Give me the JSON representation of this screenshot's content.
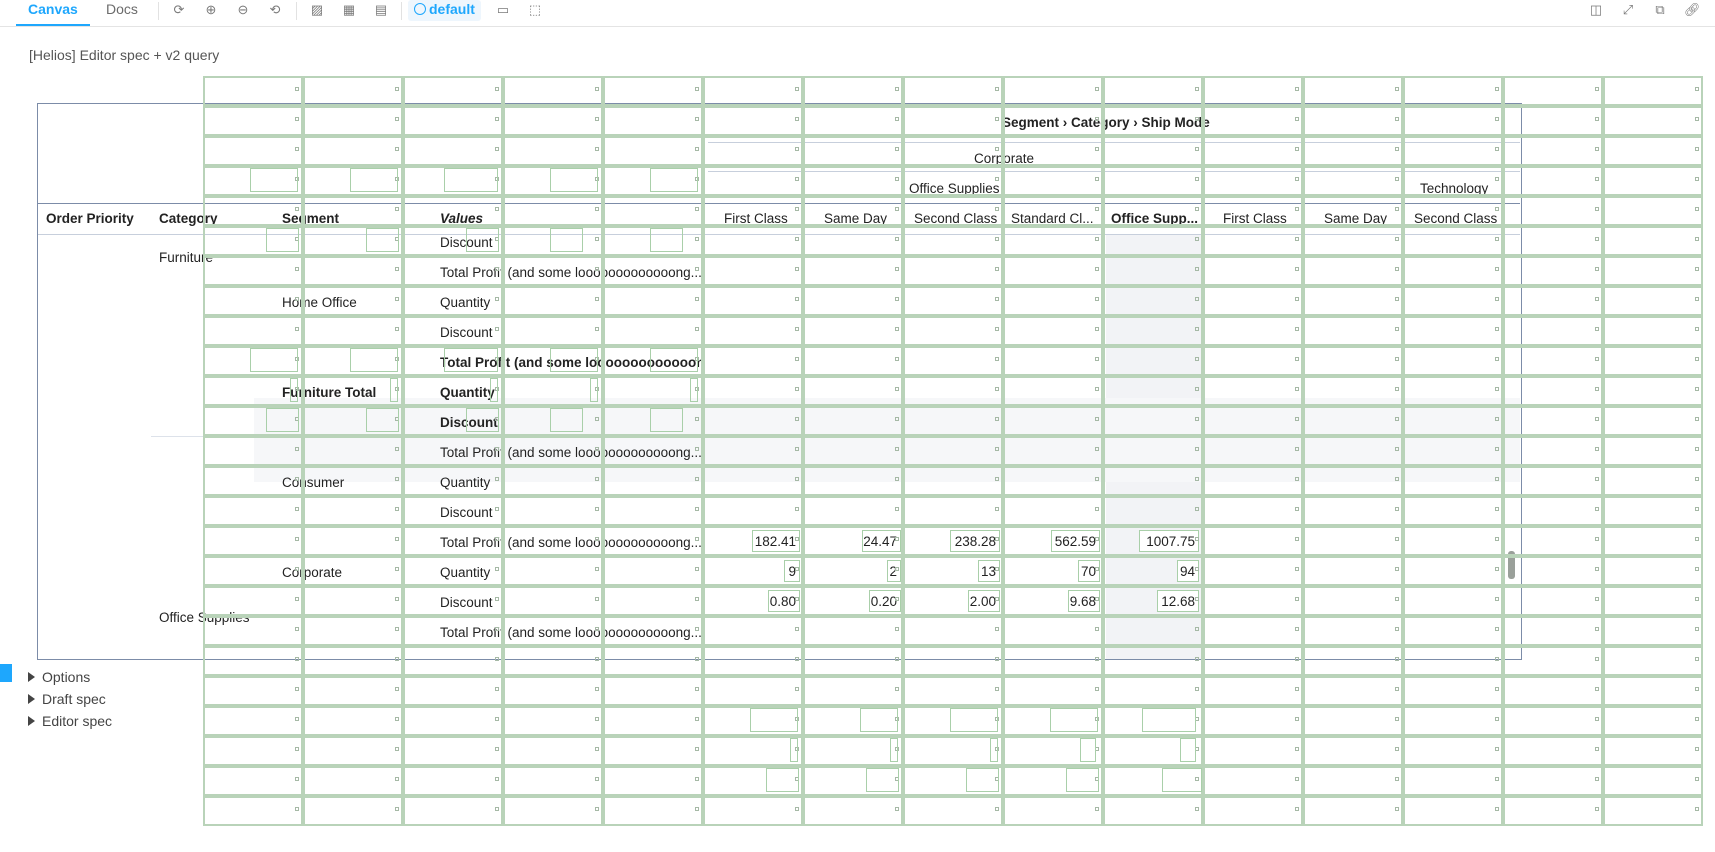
{
  "toolbar": {
    "tab_canvas": "Canvas",
    "tab_docs": "Docs",
    "globals_chip": "default",
    "icons": [
      "sync-icon",
      "zoom-in-icon",
      "zoom-out-icon",
      "zoom-reset-icon",
      "background-icon",
      "grid-icon",
      "outline-icon",
      "measure-icon",
      "viewport-icon",
      "sidebar-icon",
      "fullscreen-icon",
      "open-new-tab-icon",
      "copy-link-icon"
    ]
  },
  "story": {
    "title": "[Helios] Editor spec + v2 query"
  },
  "pivot": {
    "column_path": "Segment › Category › Ship Mode",
    "segment_header": "Corporate",
    "category_headers": [
      "Office Supplies",
      "Technology"
    ],
    "row_headers": [
      "Order Priority",
      "Category",
      "Segment",
      "Values"
    ],
    "col_headers": [
      "First Class",
      "Same Day",
      "Second Class",
      "Standard Cl...",
      "Office Supp...",
      "First Class",
      "Same Day",
      "Second Class"
    ],
    "categories": [
      "Furniture",
      "Office Supplies"
    ],
    "segments": [
      "Home Office",
      "Furniture Total",
      "Consumer",
      "Corporate"
    ],
    "value_names": {
      "discount": "Discount",
      "profit": "Total Profit (and some looooooooooooong...",
      "quantity": "Quantity"
    },
    "corporate_values": {
      "profit": [
        "182.41",
        "24.47",
        "238.28",
        "562.59",
        "1007.75"
      ],
      "quantity": [
        "9",
        "2",
        "13",
        "70",
        "94"
      ],
      "discount": [
        "0.80",
        "0.20",
        "2.00",
        "9.68",
        "12.68"
      ]
    }
  },
  "panels": [
    "Options",
    "Draft spec",
    "Editor spec"
  ]
}
